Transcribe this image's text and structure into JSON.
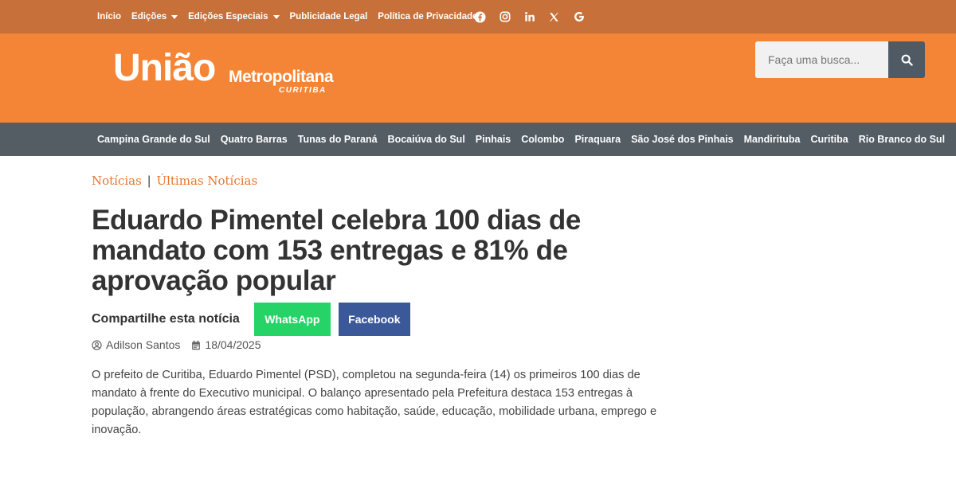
{
  "topnav": {
    "items": [
      "Início",
      "Edições",
      "Edições Especiais",
      "Publicidade Legal",
      "Política de Privacidade"
    ]
  },
  "social": {
    "icons": [
      "facebook-icon",
      "instagram-icon",
      "linkedin-icon",
      "x-icon",
      "google-icon"
    ]
  },
  "logo": {
    "main": "União",
    "sub": "Metropolitana",
    "city": "CURITIBA"
  },
  "search": {
    "placeholder": "Faça uma busca..."
  },
  "citynav": {
    "items": [
      "Campina Grande do Sul",
      "Quatro Barras",
      "Tunas do Paraná",
      "Bocaiúva do Sul",
      "Pinhais",
      "Colombo",
      "Piraquara",
      "São José dos Pinhais",
      "Mandirituba",
      "Curitiba",
      "Rio Branco do Sul"
    ]
  },
  "breadcrumb": {
    "first": "Notícias",
    "separator": "|",
    "second": "Últimas Notícias"
  },
  "article": {
    "title": "Eduardo Pimentel celebra 100 dias de mandato com 153 entregas e 81% de aprovação popular",
    "share_label": "Compartilhe esta notícia",
    "whatsapp_label": "WhatsApp",
    "facebook_label": "Facebook",
    "author": "Adilson Santos",
    "date": "18/04/2025",
    "body": "O prefeito de Curitiba, Eduardo Pimentel (PSD), completou na segunda-feira (14) os primeiros 100 dias de mandato à frente do Executivo municipal. O balanço apresentado pela Prefeitura destaca 153 entregas à população, abrangendo áreas estratégicas como habitação, saúde, educação, mobilidade urbana, emprego e inovação."
  },
  "colors": {
    "topbar": "#c8703a",
    "header": "#f48536",
    "citynav": "#545c64",
    "accent": "#e8762c",
    "whatsapp": "#25d366",
    "facebook": "#3b5998"
  }
}
